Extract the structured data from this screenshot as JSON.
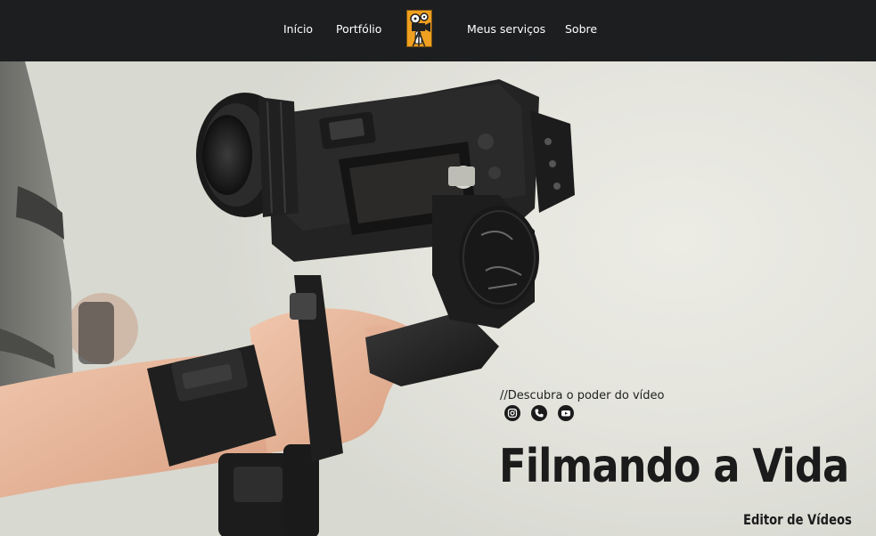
{
  "nav": {
    "links": [
      {
        "label": "Início"
      },
      {
        "label": "Portfólio"
      },
      {
        "label": "Meus serviços"
      },
      {
        "label": "Sobre"
      }
    ],
    "logo_icon": "videographer-logo"
  },
  "hero": {
    "tagline": "//Descubra o poder do vídeo",
    "social": [
      {
        "icon": "instagram-icon"
      },
      {
        "icon": "phone-icon"
      },
      {
        "icon": "youtube-icon"
      }
    ],
    "headline": "Filmando a Vida",
    "subtitle": "Editor de Vídeos",
    "background_icon": "camera-gimbal-photo"
  },
  "colors": {
    "nav_bg": "#1d1e20",
    "hero_bg": "#e3e3dc",
    "logo_accent": "#f0a020",
    "text_dark": "#1b1b1b"
  }
}
